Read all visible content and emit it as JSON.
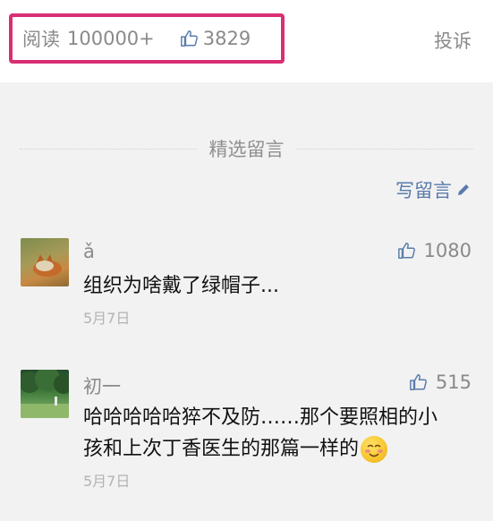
{
  "header": {
    "read_label": "阅读",
    "read_count": "100000+",
    "like_count": "3829",
    "report_label": "投诉"
  },
  "comments_section": {
    "title": "精选留言",
    "write_label": "写留言"
  },
  "comments": [
    {
      "nickname": "ǎ",
      "likes": "1080",
      "text": "组织为啥戴了绿帽子...",
      "date": "5月7日",
      "avatar": "fox-photo"
    },
    {
      "nickname": "初一",
      "likes": "515",
      "text_line1": "哈哈哈哈哈猝不及防……那个要照相的小",
      "text_line2": "孩和上次丁香医生的那篇一样的",
      "emoji": "smiling-blush-emoji",
      "date": "5月7日",
      "avatar": "forest-photo"
    }
  ],
  "colors": {
    "highlight_border": "#d92e73",
    "link_blue": "#5a7bab",
    "muted_text": "#8a8a8a",
    "thumb_icon_blue": "#5a7bab"
  }
}
